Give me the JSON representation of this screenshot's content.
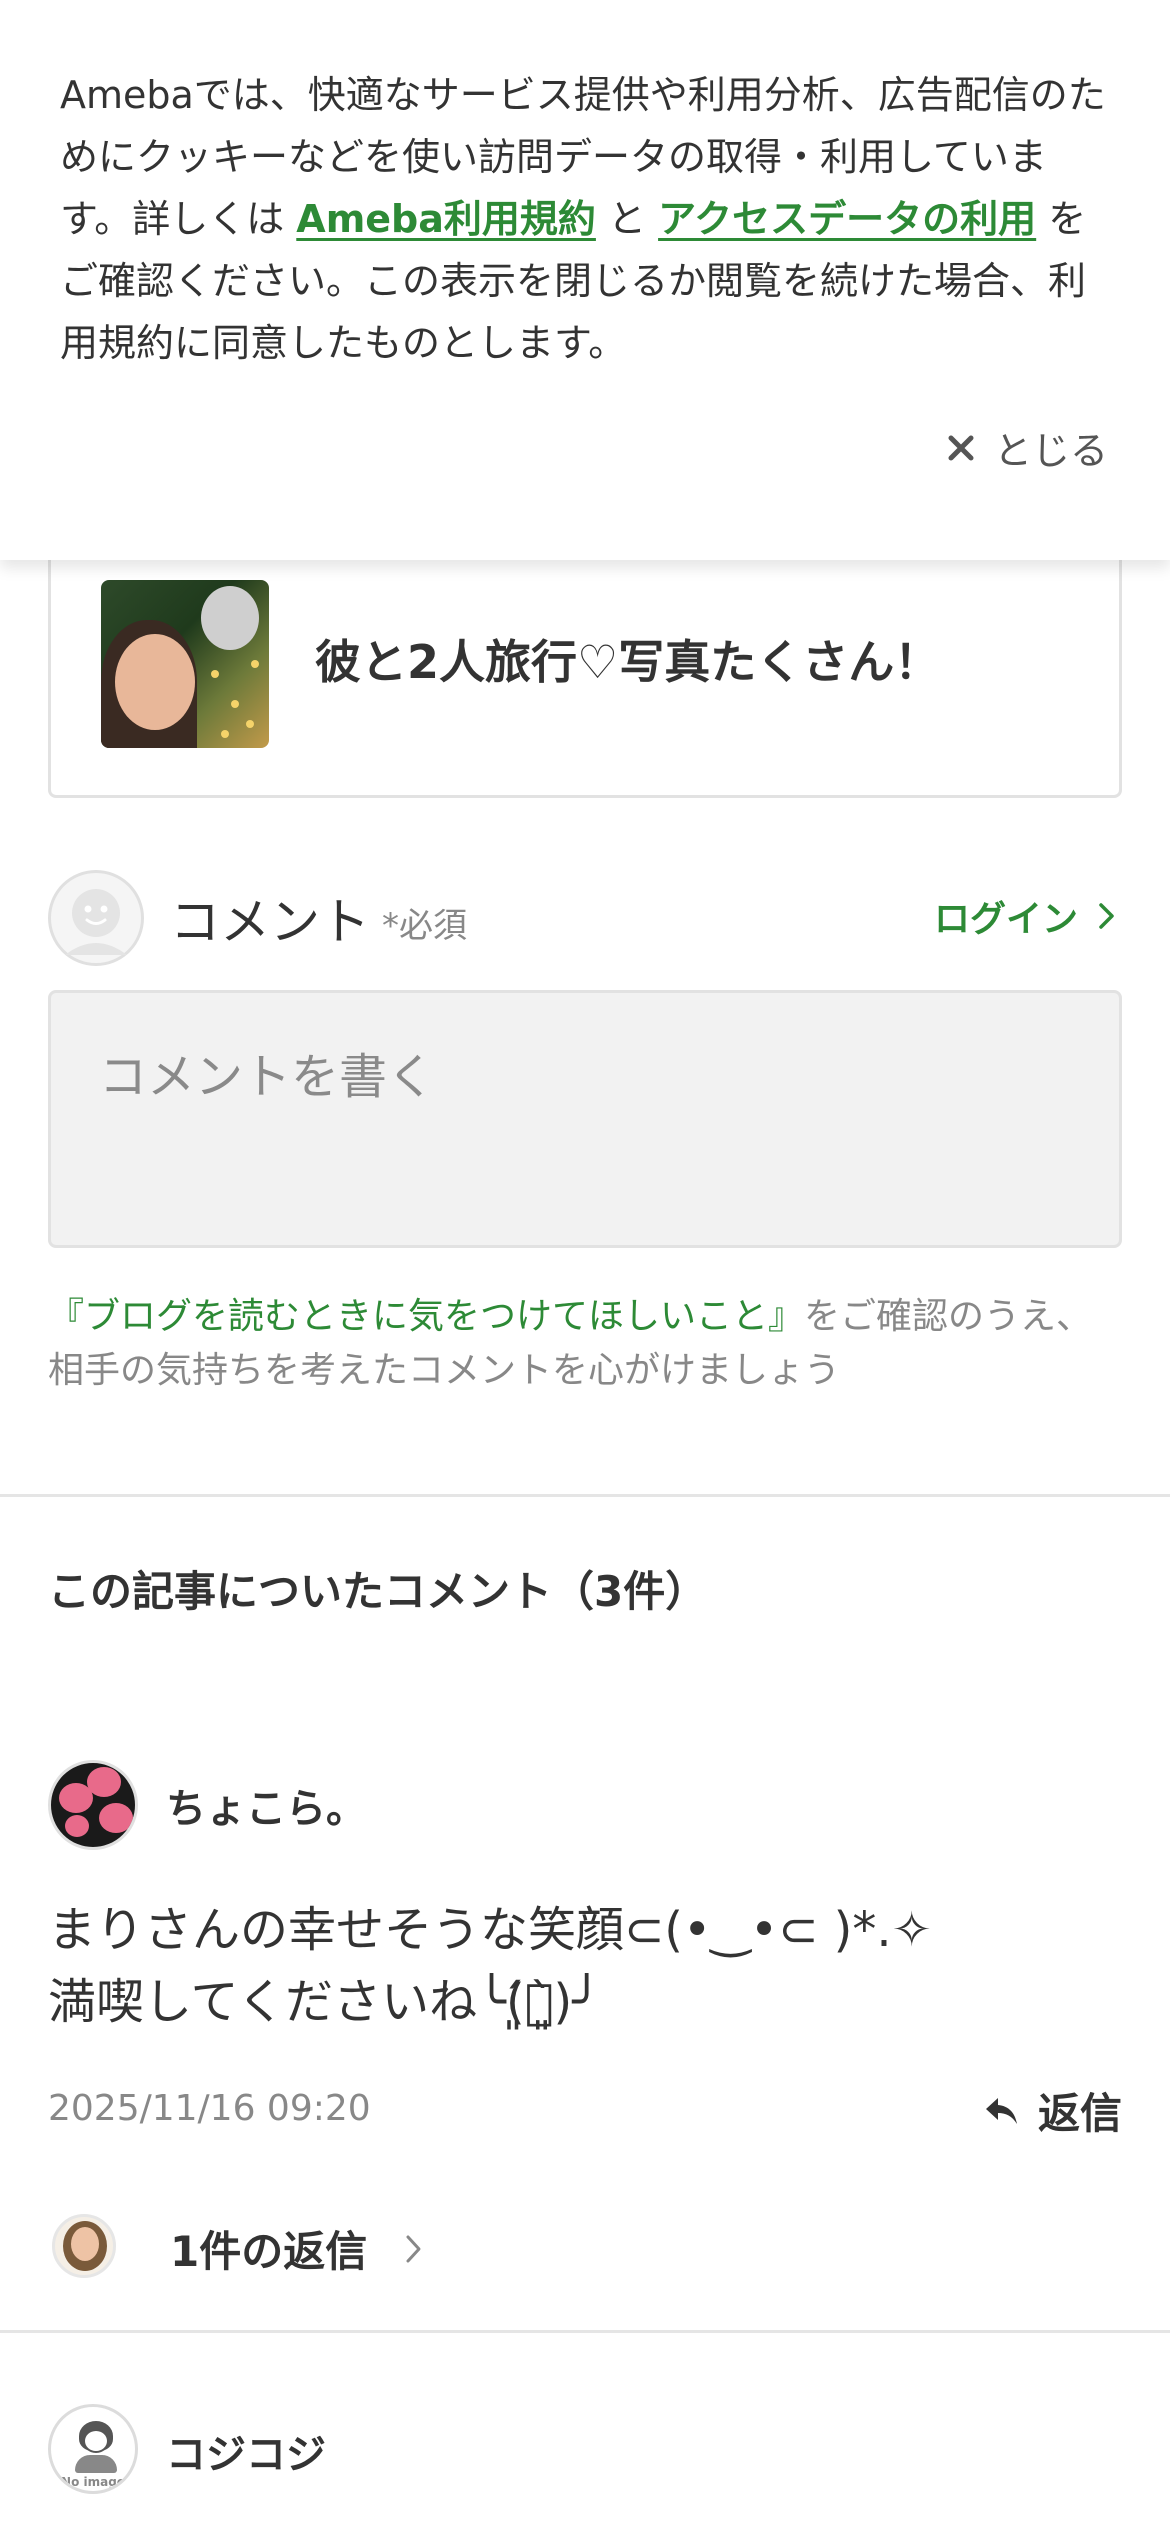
{
  "cookie_banner": {
    "text_before": "Amebaでは、快適なサービス提供や利用分析、広告配信のためにクッキーなどを使い訪問データの取得・利用しています。詳しくは ",
    "link_terms": "Ameba利用規約",
    "text_middle": " と ",
    "link_access": "アクセスデータの利用",
    "text_after": " をご確認ください。この表示を閉じるか閲覧を続けた場合、利用規約に同意したものとします。",
    "close_label": "とじる"
  },
  "blog_card": {
    "title": "彼と2人旅行♡写真たくさん！"
  },
  "comment_form": {
    "heading": "コメント",
    "required": "*必須",
    "login_label": "ログイン",
    "placeholder": "コメントを書く",
    "notice_link": "『ブログを読むときに気をつけてほしいこと』",
    "notice_text": "をご確認のうえ、相手の気持ちを考えたコメントを心がけましょう"
  },
  "comments_section": {
    "title": "この記事についたコメント（3件）",
    "items": [
      {
        "name": "ちょこら。",
        "body_line1": "まりさんの幸せそうな笑顔⊂(•‿•⊂ )*.✧",
        "body_line2": "満喫してくださいね╰(͈́︶͈̀)╯",
        "date": "2025/11/16 09:20",
        "reply_label": "返信",
        "replies_label": "1件の返信"
      },
      {
        "name": "コジコジ",
        "avatar_text": "No image"
      }
    ]
  },
  "colors": {
    "accent_green": "#2d8a36",
    "text_main": "#333333",
    "text_muted": "#888888"
  }
}
